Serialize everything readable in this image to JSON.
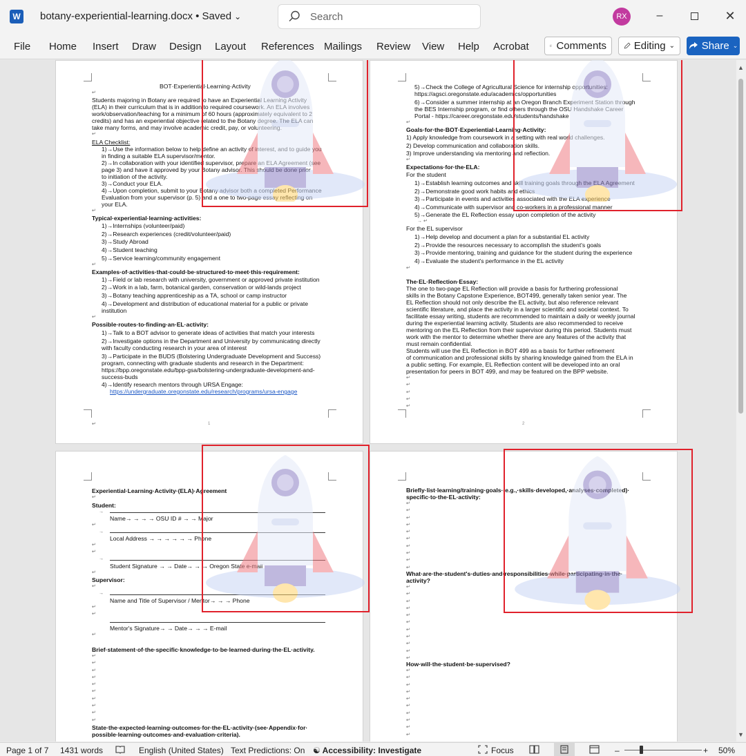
{
  "app": {
    "icon_letter": "W",
    "doc_title": "botany-experiential-learning.docx • Saved",
    "search_placeholder": "Search",
    "user_initials": "RX",
    "accent": "#1a63c0"
  },
  "ribbon": {
    "tabs": [
      "File",
      "Home",
      "Insert",
      "Draw",
      "Design",
      "Layout",
      "References",
      "Mailings",
      "Review",
      "View",
      "Help",
      "Acrobat"
    ],
    "comments_label": "Comments",
    "editing_label": "Editing",
    "share_label": "Share"
  },
  "page1": {
    "title": "BOT·Experiential·Learning·Activity",
    "intro": [
      "Students majoring in Botany are required to have an Experiential Learning Activity",
      "(ELA) in their curriculum that is in addition to required coursework. An ELA involves",
      "work/observation/teaching for a minimum of 60 hours (approximately equivalent to 2",
      "credits) and has an experiential objective related to the Botany degree. The ELA can",
      "take many forms, and may involve academic credit, pay, or volunteering."
    ],
    "checklist_heading": "ELA Checklist:",
    "checklist": [
      "1)→Use the information below to help define an activity of interest, and to guide you",
      "      in finding a suitable ELA supervisor/mentor.",
      "2)→In collaboration with your identified supervisor, prepare an ELA Agreement (see",
      "      page 3) and have it approved by your Botany advisor.  This should be done prior",
      "      to initiation of the activity.",
      "3)→Conduct your ELA.",
      "4)→Upon completion, submit to your Botany advisor both a completed Performance",
      "      Evaluation from your supervisor (p. 5) and a one to two-page essay reflecting on",
      "      your ELA."
    ],
    "typical_heading": "Typical·experiential·learning·activities:",
    "typical": [
      "1)→Internships (volunteer/paid)",
      "2)→Research experiences (credit/volunteer/paid)",
      "3)→Study Abroad",
      "4)→Student teaching",
      "5)→Service learning/community engagement"
    ],
    "examples_heading": "Examples·of·activities·that·could·be·structured·to·meet·this·requirement:",
    "examples": [
      "1)→Field or lab research with university, government or approved private institution",
      "2)→Work in a lab, farm, botanical garden, conservation or wild-lands project",
      "3)→Botany teaching apprenticeship as a TA, school or camp instructor",
      "4)→Development and distribution of educational material for a public or private",
      "      institution"
    ],
    "routes_heading": "Possible·routes·to·finding·an·EL·activity:",
    "routes": [
      "1)→Talk to a BOT advisor to generate ideas of activities that match your interests",
      "2)→Investigate options in the Department and University by communicating directly",
      "      with faculty conducting research in your area of interest",
      "3)→Participate in the BUDS (Bolstering Undergraduate Development and Success)",
      "      program, connecting with graduate students and research in the Department:",
      "      https://bpp.oregonstate.edu/bpp-gsa/bolstering-undergraduate-development-and-",
      "      success-buds",
      "4)→Identify research mentors through URSA Engage:"
    ],
    "ursa_link": "https://undergraduate.oregonstate.edu/research/programs/ursa-engage",
    "page_number": "1"
  },
  "page2": {
    "items_top": [
      "5)→Check the College of Agricultural Science for internship opportunities:",
      "      https://agsci.oregonstate.edu/academics/opportunities",
      "6)→Consider a summer internship at an Oregon Branch Experiment Station through",
      "      the BES Internship program, or find others through the OSU Handshake Career",
      "      Portal - https://career.oregonstate.edu/students/handshake"
    ],
    "goals_heading": "Goals·for·the·BOT·Experiential·Learning·Activity:",
    "goals": [
      "1) Apply knowledge from coursework in a setting with real world challenges.",
      "2) Develop communication and collaboration skills.",
      "3) Improve understanding via mentoring and reflection."
    ],
    "expect_heading": "Expectations·for·the·ELA:",
    "for_student": "For the student",
    "student_items": [
      "1)→Establish learning outcomes and skill training goals through the ELA Agreement",
      "2)→Demonstrate good work habits and ethics",
      "3)→Participate in events and activities associated with the ELA experience",
      "4)→Communicate with supervisor and co-workers in a professional manner",
      "5)→Generate the EL Reflection essay upon completion of the activity"
    ],
    "for_supervisor": "For the EL supervisor",
    "supervisor_items": [
      "1)→Help develop and document a plan for a substantial EL activity",
      "2)→Provide the resources necessary to accomplish the student's goals",
      "3)→Provide mentoring, training and guidance for the student during the experience",
      "4)→Evaluate the student's performance in the EL activity"
    ],
    "essay_heading": "The·EL·Reflection·Essay:",
    "essay": [
      "          The one to two-page EL Reflection will provide a basis for furthering professional",
      "skills in the Botany Capstone Experience, BOT499, generally taken senior year.  The",
      "EL Reflection should not only describe the EL activity, but also reference relevant",
      "scientific literature, and place the activity in a larger scientific and societal context.  To",
      "facilitate essay writing, students are recommended to maintain a daily or weekly journal",
      "during the experiential learning activity. Students are also recommended to receive",
      "mentoring on the EL Reflection from their supervisor during this period. Students must",
      "work with the mentor to determine whether there are any features of the activity that",
      "must remain confidential.",
      "          Students will use the EL Reflection in BOT 499 as a basis for further refinement",
      "of communication and professional skills by sharing knowledge gained from the ELA in",
      "a public setting. For example, EL Reflection content will be developed into an oral",
      "presentation for peers in BOT 499, and may be featured on the BPP website."
    ],
    "page_number": "2"
  },
  "page3": {
    "title": "Experiential·Learning·Activity·(ELA)·Agreement",
    "student_heading": "Student:",
    "name_row": "Name→        →        →        →        OSU ID #  →        →        Major",
    "address_row": "Local Address  →        →        →        →        →        →        Phone",
    "signature_row": "Student Signature →      →      Date→      →      →      Oregon State e-mail",
    "supervisor_heading": "Supervisor:",
    "supervisor_row": "Name and Title of Supervisor / Mentor→      →      →      Phone",
    "mentor_sig_row": "Mentor's Signature→      →      Date→      →      →      E-mail",
    "brief_heading": "Brief·statement·of·the·specific·knowledge·to·be·learned·during·the·EL·activity.",
    "outcomes_heading_1": "State·the·expected·learning·outcomes·for·the·EL·activity·(see·Appendix·for·",
    "outcomes_heading_2": "possible·learning·outcomes·and·evaluation·criteria)."
  },
  "page4": {
    "goals_heading_1": "Briefly·list·learning/training·goals·(e.g.,·skills·developed,·analyses·completed)·",
    "goals_heading_2": "specific·to·the·EL·activity:",
    "duties_heading_1": "What·are·the·student's·duties·and·responsibilities·while·participating·in·the·",
    "duties_heading_2": "activity?",
    "supervised_heading": "How·will·the·student·be·supervised?"
  },
  "status": {
    "page": "Page 1 of 7",
    "words": "1431 words",
    "language": "English (United States)",
    "text_predictions": "Text Predictions: On",
    "accessibility": "Accessibility: Investigate",
    "focus": "Focus",
    "zoom": "50%",
    "zoom_fraction": 0.25
  }
}
